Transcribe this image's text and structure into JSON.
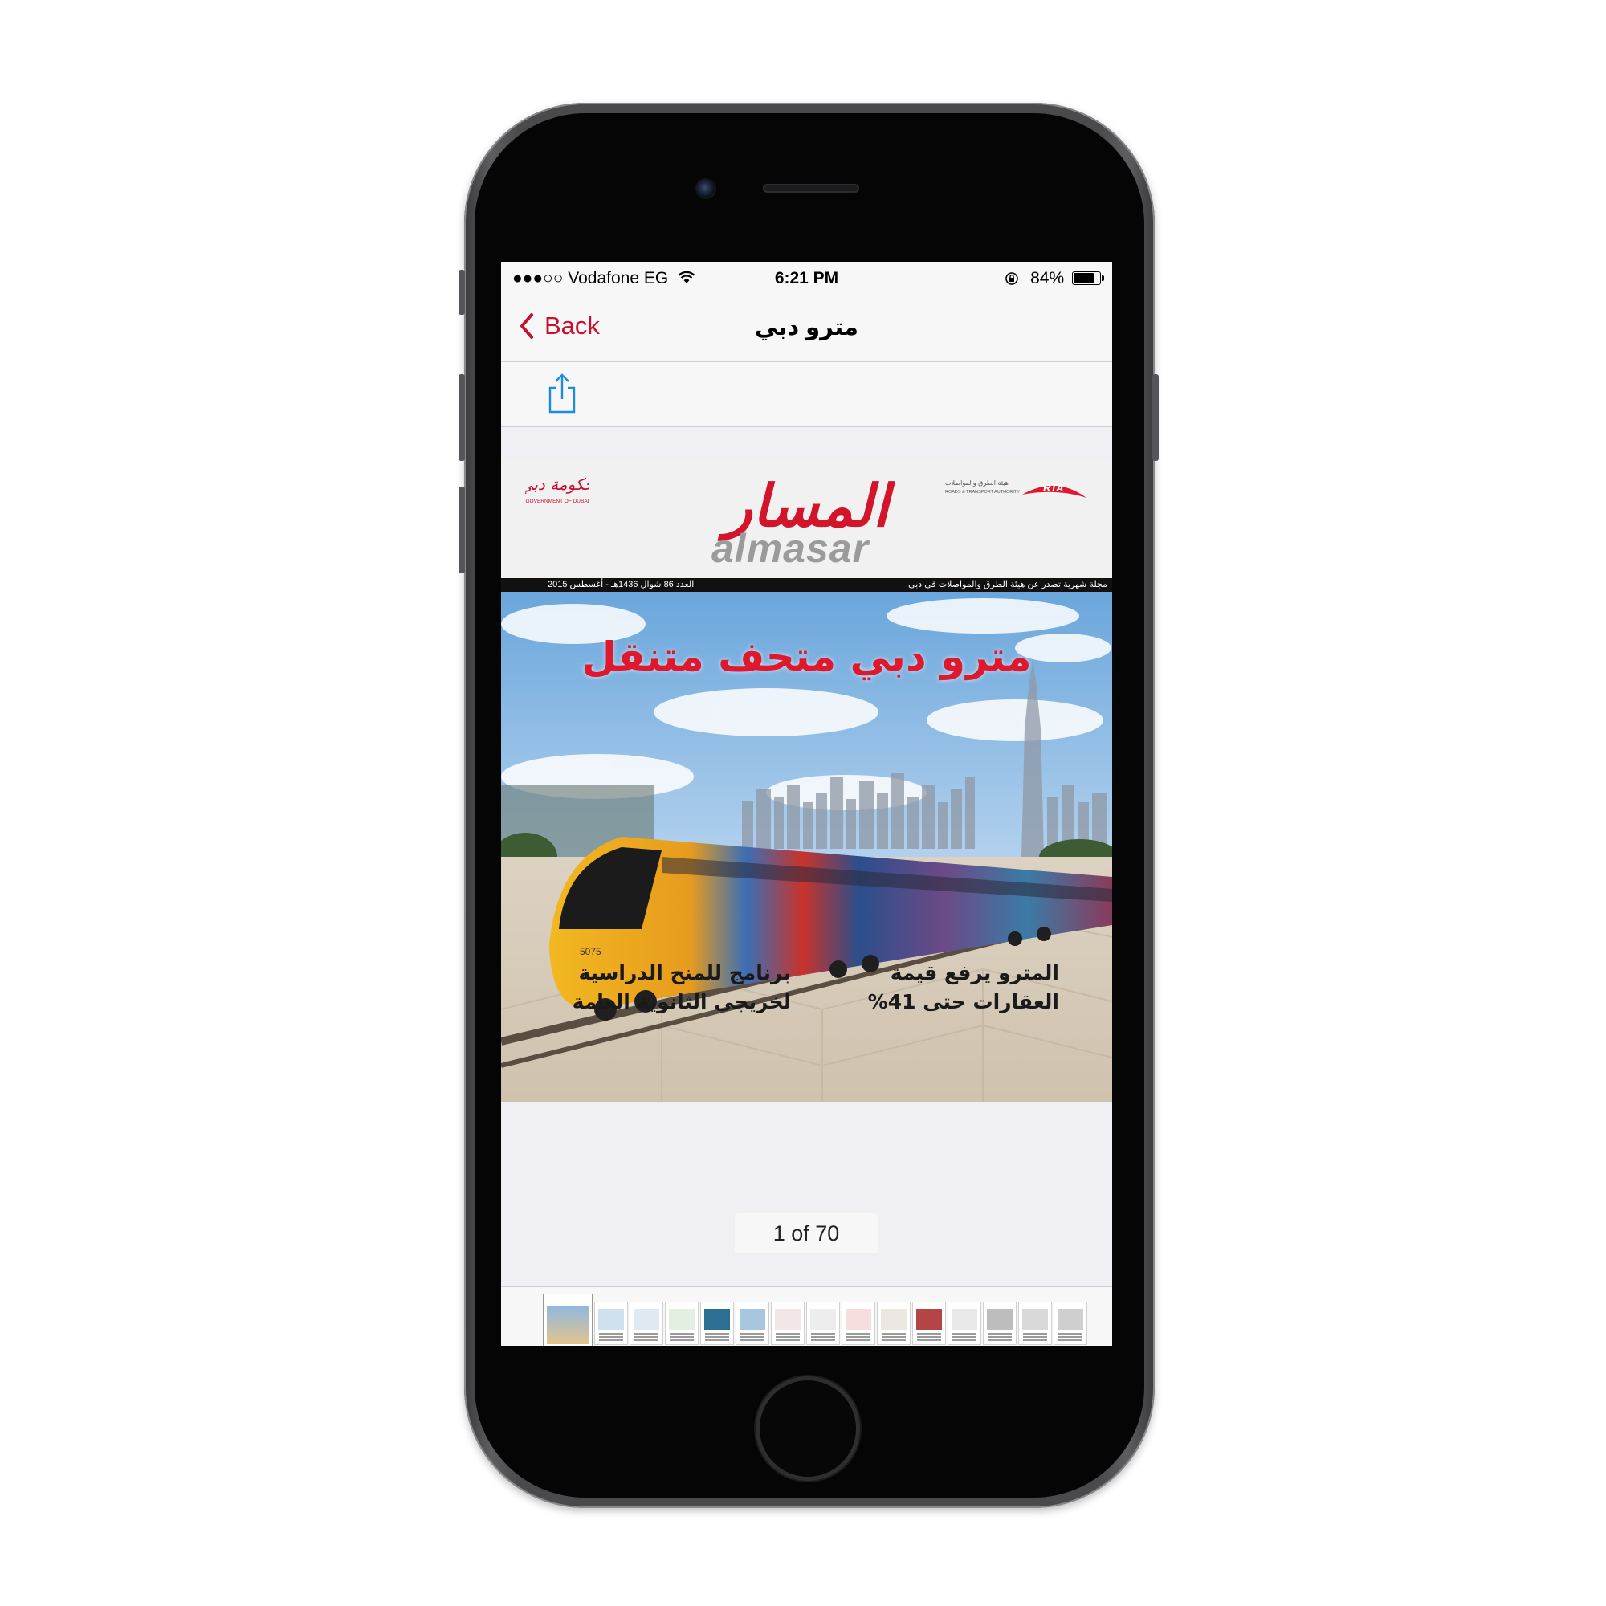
{
  "status_bar": {
    "carrier": "Vodafone EG",
    "time": "6:21 PM",
    "battery": "84%",
    "battery_level": 0.84
  },
  "nav": {
    "back_label": "Back",
    "title": "مترو دبي"
  },
  "toolbar": {
    "share_icon": "share-icon"
  },
  "magazine": {
    "gov_logo_text": "حكومة دبي",
    "gov_logo_caption": "GOVERNMENT OF DUBAI",
    "rta_logo_text": "RTA",
    "rta_logo_ar": "هيئة الطرق والمواصلات",
    "rta_logo_en": "ROADS & TRANSPORT AUTHORITY",
    "masthead_ar": "المسار",
    "masthead_en": "almasar",
    "strip_left": "العدد 86  شوال 1436هـ - أغسطس 2015",
    "strip_right": "مجلة شهرية تصدر عن هيئة الطرق والمواصلات في دبي",
    "headline": "مترو دبي متحف متنقل",
    "train_number": "5075",
    "story_right_line1": "المترو يرفع قيمة",
    "story_right_line2": "العقارات حتى 41%",
    "story_left_line1": "برنامج للمنح الدراسية",
    "story_left_line2": "لخريجي الثانوية العامة"
  },
  "pager": {
    "label": "1 of 70",
    "current_page": 1,
    "total_pages": 70
  },
  "thumbnails": {
    "count": 15,
    "selected_index": 0
  },
  "colors": {
    "accent": "#c8102e",
    "headline": "#e0182e",
    "share_blue": "#1f8be0"
  }
}
